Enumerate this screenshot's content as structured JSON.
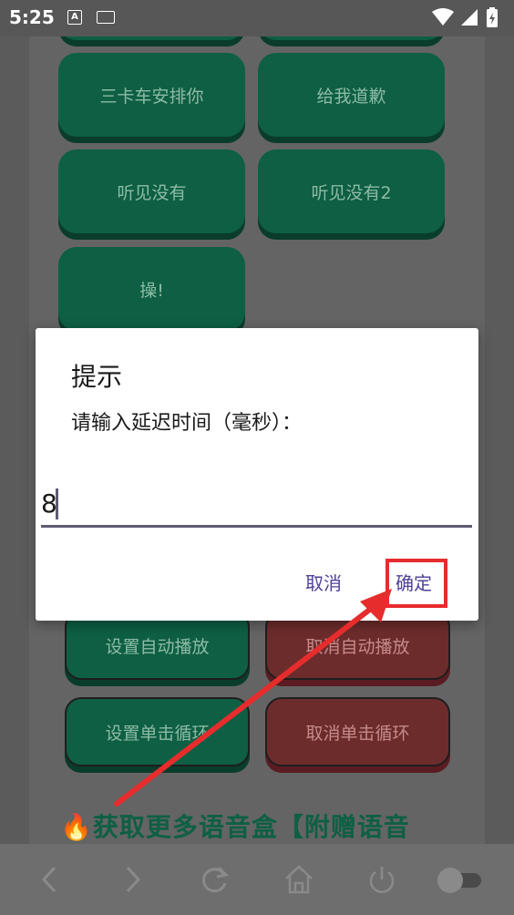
{
  "status_bar": {
    "time": "5:25",
    "indicator_a": "A"
  },
  "buttons": {
    "b1": "三卡车安排你",
    "b2": "给我道歉",
    "b3": "听见没有",
    "b4": "听见没有2",
    "b5": "操!",
    "set_auto": "设置自动播放",
    "cancel_auto": "取消自动播放",
    "set_loop": "设置单击循环",
    "cancel_loop": "取消单击循环"
  },
  "promo": {
    "icon": "fire-icon",
    "text": "获取更多语音盒【附赠语音"
  },
  "dialog": {
    "title": "提示",
    "message": "请输入延迟时间（毫秒）：",
    "input_value": "8",
    "cancel_label": "取消",
    "ok_label": "确定"
  },
  "colors": {
    "button_green": "#0e5f44",
    "button_red": "#6d2c2c",
    "dialog_accent": "#4f3f99",
    "annotation_red": "#e62c2c"
  }
}
